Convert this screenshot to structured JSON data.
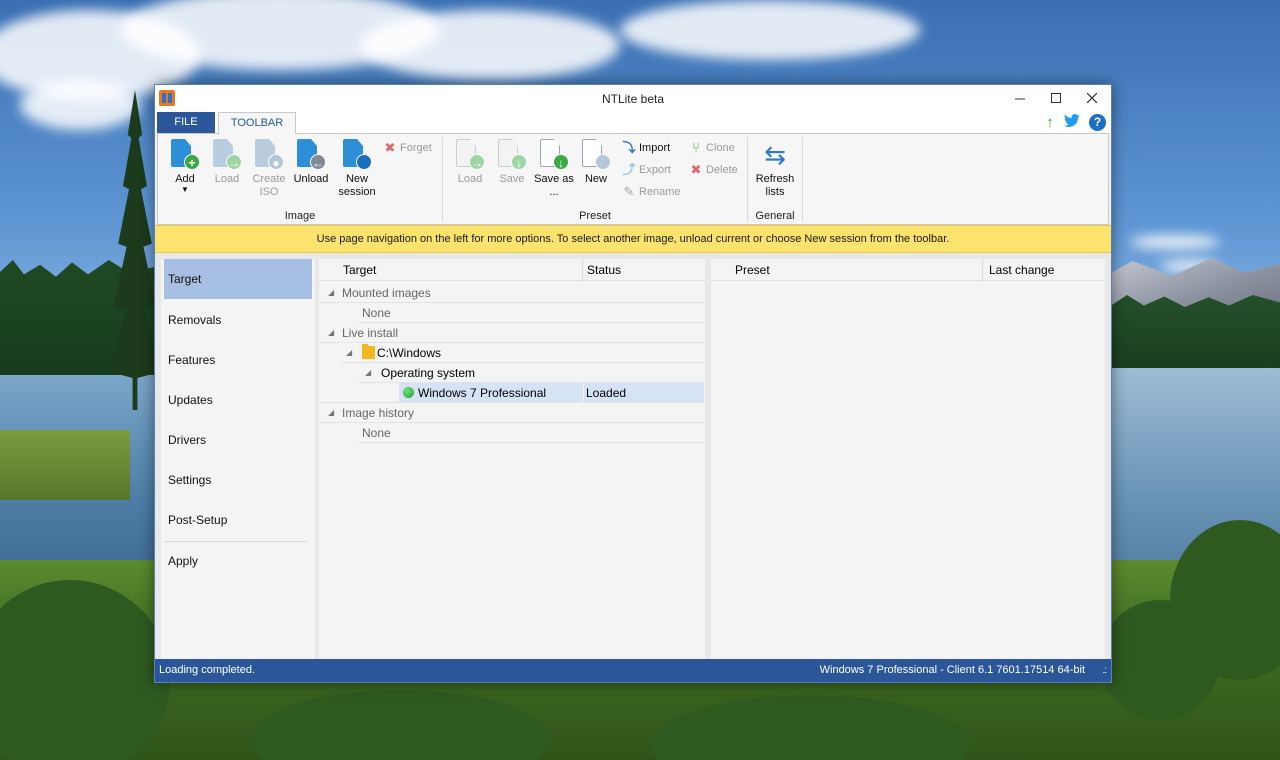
{
  "window": {
    "title": "NTLite beta"
  },
  "tabs": {
    "file": "FILE",
    "toolbar": "TOOLBAR"
  },
  "quick_access": {
    "icons": [
      "upgrade-arrow-icon",
      "twitter-icon",
      "help-icon"
    ]
  },
  "ribbon": {
    "image_group": {
      "label": "Image",
      "add": "Add",
      "load": "Load",
      "create_iso": "Create ISO",
      "unload": "Unload",
      "new_session": "New session",
      "forget": "Forget"
    },
    "preset_group": {
      "label": "Preset",
      "load": "Load",
      "save": "Save",
      "save_as": "Save as ...",
      "new": "New",
      "import": "Import",
      "export": "Export",
      "rename": "Rename",
      "clone": "Clone",
      "delete": "Delete"
    },
    "general_group": {
      "label": "General",
      "refresh_lists": "Refresh lists"
    }
  },
  "infobar": {
    "text": "Use page navigation on the left for more options. To select another image, unload current or choose New session from the toolbar."
  },
  "nav": {
    "items": [
      "Target",
      "Removals",
      "Features",
      "Updates",
      "Drivers",
      "Settings",
      "Post-Setup",
      "Apply"
    ],
    "selected": "Target"
  },
  "target_panel": {
    "columns": [
      "Target",
      "Status"
    ],
    "mounted_images": "Mounted images",
    "mounted_none": "None",
    "live_install": "Live install",
    "windows_path": "C:\\Windows",
    "operating_system": "Operating system",
    "os_name": "Windows 7 Professional",
    "os_status": "Loaded",
    "image_history": "Image history",
    "history_none": "None"
  },
  "preset_panel": {
    "columns": [
      "Preset",
      "Last change"
    ]
  },
  "statusbar": {
    "left": "Loading completed.",
    "right": "Windows 7 Professional - Client 6.1 7601.17514 64-bit"
  },
  "colors": {
    "accent_blue": "#2b579a",
    "infobar_yellow": "#fbe36e",
    "nav_selected": "#a7bfe2",
    "row_selected": "#d6e3f5"
  }
}
